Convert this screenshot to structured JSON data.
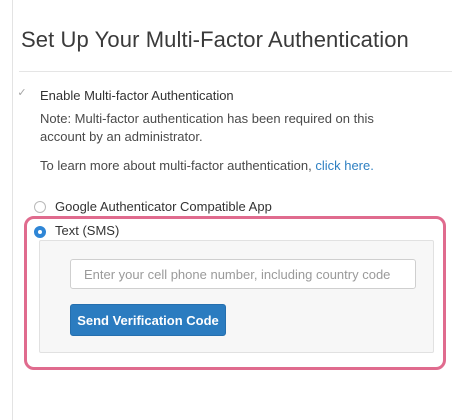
{
  "page": {
    "title": "Set Up Your Multi-Factor Authentication"
  },
  "mfa": {
    "enable_label": "Enable Multi-factor Authentication",
    "enable_checked": true,
    "note": "Note: Multi-factor authentication has been required on this account by an administrator.",
    "learn_more_text": "To learn more about multi-factor authentication,",
    "learn_more_link": "click here."
  },
  "methods": {
    "options": [
      {
        "label": "Google Authenticator Compatible App",
        "selected": false
      },
      {
        "label": "Text (SMS)",
        "selected": true
      }
    ]
  },
  "sms": {
    "phone_placeholder": "Enter your cell phone number, including country code",
    "phone_value": "",
    "send_button_label": "Send Verification Code"
  },
  "colors": {
    "accent": "#2b7cc0",
    "link": "#2f80c2",
    "highlight_border": "#e06b8e"
  },
  "icons": {
    "enable_checkbox": "check-icon"
  }
}
